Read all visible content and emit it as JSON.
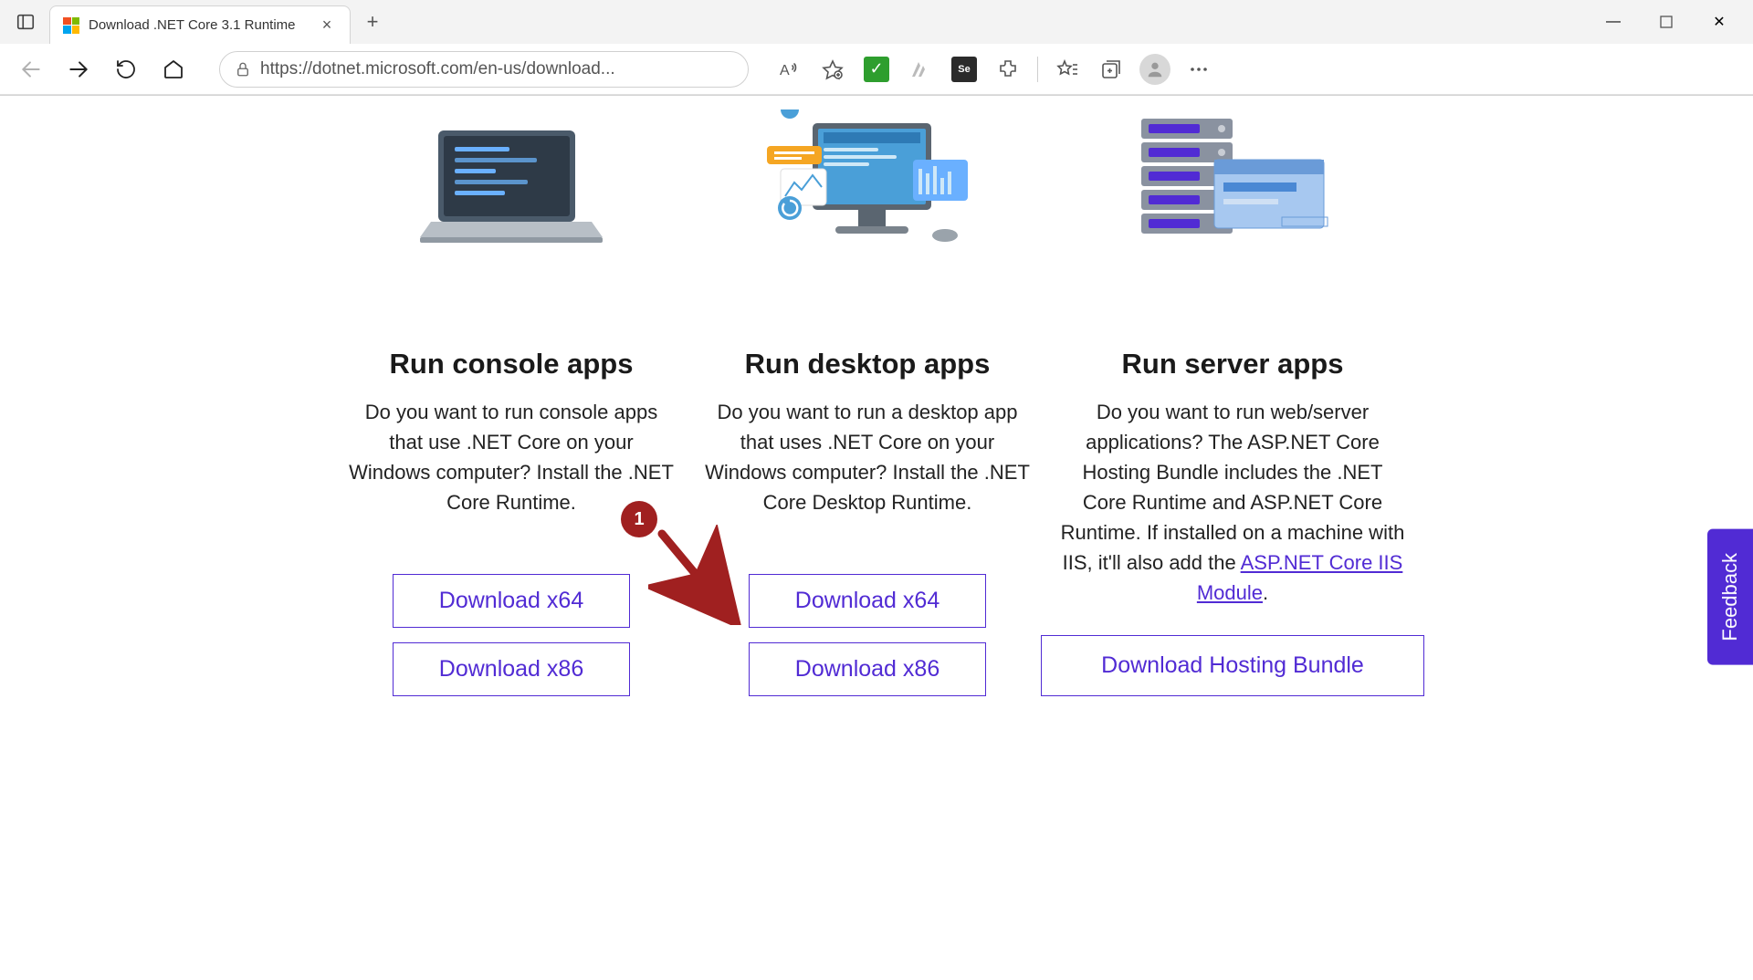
{
  "browser": {
    "tab_title": "Download .NET Core 3.1 Runtime",
    "url": "https://dotnet.microsoft.com/en-us/download...",
    "new_tab_symbol": "+",
    "close_symbol": "×"
  },
  "window_controls": {
    "minimize": "—",
    "maximize": "▢",
    "close": "✕"
  },
  "columns": [
    {
      "heading": "Run console apps",
      "desc": "Do you want to run console apps that use .NET Core on your Windows computer? Install the .NET Core Runtime.",
      "link_text": "",
      "buttons": [
        "Download x64",
        "Download x86"
      ]
    },
    {
      "heading": "Run desktop apps",
      "desc": "Do you want to run a desktop app that uses .NET Core on your Windows computer? Install the .NET Core Desktop Runtime.",
      "link_text": "",
      "buttons": [
        "Download x64",
        "Download x86"
      ]
    },
    {
      "heading": "Run server apps",
      "desc": "Do you want to run web/server applications? The ASP.NET Core Hosting Bundle includes the .NET Core Runtime and ASP.NET Core Runtime. If installed on a machine with IIS, it'll also add the ",
      "link_text": "ASP.NET Core IIS Module",
      "desc_after": ".",
      "buttons": [
        "Download Hosting Bundle"
      ]
    }
  ],
  "annotation": {
    "label": "1"
  },
  "feedback": {
    "label": "Feedback"
  },
  "selenium_badge": "Se"
}
